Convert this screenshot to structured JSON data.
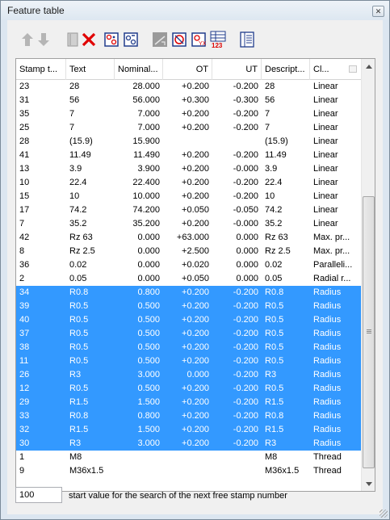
{
  "window": {
    "title": "Feature table",
    "close_glyph": "✕"
  },
  "toolbar": {
    "buttons": [
      {
        "name": "move-up-icon",
        "enabled": false
      },
      {
        "name": "move-down-icon",
        "enabled": false
      },
      {
        "name": "notepad-icon",
        "enabled": false
      },
      {
        "name": "delete-icon",
        "enabled": true
      },
      {
        "name": "stamp-region-icon",
        "enabled": true
      },
      {
        "name": "stamp-region-2-icon",
        "enabled": true
      },
      {
        "name": "dimension-icon",
        "enabled": false
      },
      {
        "name": "renumber-icon",
        "enabled": true
      },
      {
        "name": "renumber-xy-icon",
        "enabled": true
      },
      {
        "name": "numbering-list-icon",
        "enabled": true
      },
      {
        "name": "column-settings-icon",
        "enabled": true
      }
    ]
  },
  "table": {
    "columns": [
      "Stamp t...",
      "Text",
      "Nominal...",
      "OT",
      "UT",
      "Descript...",
      "Cl..."
    ],
    "selection_color": "#3399ff",
    "rows": [
      {
        "stamp": "23",
        "text": "28",
        "nominal": "28.000",
        "ot": "+0.200",
        "ut": "-0.200",
        "desc": "28",
        "cls": "Linear",
        "selected": false
      },
      {
        "stamp": "31",
        "text": "56",
        "nominal": "56.000",
        "ot": "+0.300",
        "ut": "-0.300",
        "desc": "56",
        "cls": "Linear",
        "selected": false
      },
      {
        "stamp": "35",
        "text": "7",
        "nominal": "7.000",
        "ot": "+0.200",
        "ut": "-0.200",
        "desc": "7",
        "cls": "Linear",
        "selected": false
      },
      {
        "stamp": "25",
        "text": "7",
        "nominal": "7.000",
        "ot": "+0.200",
        "ut": "-0.200",
        "desc": "7",
        "cls": "Linear",
        "selected": false
      },
      {
        "stamp": "28",
        "text": "(15.9)",
        "nominal": "15.900",
        "ot": "",
        "ut": "",
        "desc": "(15.9)",
        "cls": "Linear",
        "selected": false
      },
      {
        "stamp": "41",
        "text": "11.49",
        "nominal": "11.490",
        "ot": "+0.200",
        "ut": "-0.200",
        "desc": "11.49",
        "cls": "Linear",
        "selected": false
      },
      {
        "stamp": "13",
        "text": "3.9",
        "nominal": "3.900",
        "ot": "+0.200",
        "ut": "-0.000",
        "desc": "3.9",
        "cls": "Linear",
        "selected": false
      },
      {
        "stamp": "10",
        "text": "22.4",
        "nominal": "22.400",
        "ot": "+0.200",
        "ut": "-0.200",
        "desc": "22.4",
        "cls": "Linear",
        "selected": false
      },
      {
        "stamp": "15",
        "text": "10",
        "nominal": "10.000",
        "ot": "+0.200",
        "ut": "-0.200",
        "desc": "10",
        "cls": "Linear",
        "selected": false
      },
      {
        "stamp": "17",
        "text": "74.2",
        "nominal": "74.200",
        "ot": "+0.050",
        "ut": "-0.050",
        "desc": "74.2",
        "cls": "Linear",
        "selected": false
      },
      {
        "stamp": "7",
        "text": "35.2",
        "nominal": "35.200",
        "ot": "+0.200",
        "ut": "-0.000",
        "desc": "35.2",
        "cls": "Linear",
        "selected": false
      },
      {
        "stamp": "42",
        "text": "Rz 63",
        "nominal": "0.000",
        "ot": "+63.000",
        "ut": "0.000",
        "desc": "Rz 63",
        "cls": "Max. pr...",
        "selected": false
      },
      {
        "stamp": "8",
        "text": "Rz 2.5",
        "nominal": "0.000",
        "ot": "+2.500",
        "ut": "0.000",
        "desc": "Rz 2.5",
        "cls": "Max. pr...",
        "selected": false
      },
      {
        "stamp": "36",
        "text": "0.02",
        "nominal": "0.000",
        "ot": "+0.020",
        "ut": "0.000",
        "desc": "0.02",
        "cls": "Paralleli...",
        "selected": false
      },
      {
        "stamp": "2",
        "text": "0.05",
        "nominal": "0.000",
        "ot": "+0.050",
        "ut": "0.000",
        "desc": "0.05",
        "cls": "Radial r...",
        "selected": false
      },
      {
        "stamp": "34",
        "text": "R0.8",
        "nominal": "0.800",
        "ot": "+0.200",
        "ut": "-0.200",
        "desc": "R0.8",
        "cls": "Radius",
        "selected": true
      },
      {
        "stamp": "39",
        "text": "R0.5",
        "nominal": "0.500",
        "ot": "+0.200",
        "ut": "-0.200",
        "desc": "R0.5",
        "cls": "Radius",
        "selected": true
      },
      {
        "stamp": "40",
        "text": "R0.5",
        "nominal": "0.500",
        "ot": "+0.200",
        "ut": "-0.200",
        "desc": "R0.5",
        "cls": "Radius",
        "selected": true
      },
      {
        "stamp": "37",
        "text": "R0.5",
        "nominal": "0.500",
        "ot": "+0.200",
        "ut": "-0.200",
        "desc": "R0.5",
        "cls": "Radius",
        "selected": true
      },
      {
        "stamp": "38",
        "text": "R0.5",
        "nominal": "0.500",
        "ot": "+0.200",
        "ut": "-0.200",
        "desc": "R0.5",
        "cls": "Radius",
        "selected": true
      },
      {
        "stamp": "11",
        "text": "R0.5",
        "nominal": "0.500",
        "ot": "+0.200",
        "ut": "-0.200",
        "desc": "R0.5",
        "cls": "Radius",
        "selected": true
      },
      {
        "stamp": "26",
        "text": "R3",
        "nominal": "3.000",
        "ot": "0.000",
        "ut": "-0.200",
        "desc": "R3",
        "cls": "Radius",
        "selected": true
      },
      {
        "stamp": "12",
        "text": "R0.5",
        "nominal": "0.500",
        "ot": "+0.200",
        "ut": "-0.200",
        "desc": "R0.5",
        "cls": "Radius",
        "selected": true
      },
      {
        "stamp": "29",
        "text": "R1.5",
        "nominal": "1.500",
        "ot": "+0.200",
        "ut": "-0.200",
        "desc": "R1.5",
        "cls": "Radius",
        "selected": true
      },
      {
        "stamp": "33",
        "text": "R0.8",
        "nominal": "0.800",
        "ot": "+0.200",
        "ut": "-0.200",
        "desc": "R0.8",
        "cls": "Radius",
        "selected": true
      },
      {
        "stamp": "32",
        "text": "R1.5",
        "nominal": "1.500",
        "ot": "+0.200",
        "ut": "-0.200",
        "desc": "R1.5",
        "cls": "Radius",
        "selected": true
      },
      {
        "stamp": "30",
        "text": "R3",
        "nominal": "3.000",
        "ot": "+0.200",
        "ut": "-0.200",
        "desc": "R3",
        "cls": "Radius",
        "selected": true
      },
      {
        "stamp": "1",
        "text": "M8",
        "nominal": "",
        "ot": "",
        "ut": "",
        "desc": "M8",
        "cls": "Thread",
        "selected": false
      },
      {
        "stamp": "9",
        "text": "M36x1.5",
        "nominal": "",
        "ot": "",
        "ut": "",
        "desc": "M36x1.5",
        "cls": "Thread",
        "selected": false
      }
    ]
  },
  "footer": {
    "start_value": "100",
    "start_label": "start value for the search of the next free stamp number"
  }
}
